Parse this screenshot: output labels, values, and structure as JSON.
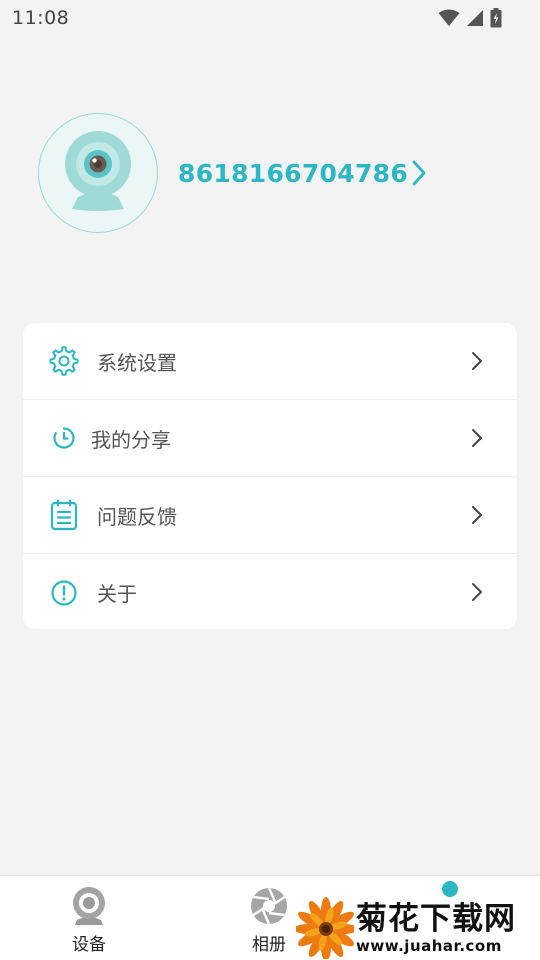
{
  "status_bar": {
    "time": "11:08"
  },
  "profile": {
    "account_id": "8618166704786"
  },
  "menu": {
    "items": [
      {
        "label": "系统设置",
        "icon": "gear-icon"
      },
      {
        "label": "我的分享",
        "icon": "share-refresh-icon"
      },
      {
        "label": "问题反馈",
        "icon": "clipboard-icon"
      },
      {
        "label": "关于",
        "icon": "info-alert-icon"
      }
    ]
  },
  "bottom_nav": {
    "items": [
      {
        "label": "设备",
        "icon": "camera-device-icon"
      },
      {
        "label": "相册",
        "icon": "aperture-icon"
      },
      {
        "label": "",
        "icon": "profile-icon"
      }
    ]
  },
  "watermark": {
    "title": "菊花下载网",
    "url": "www.juahar.com"
  },
  "colors": {
    "accent": "#2bb7c3",
    "icon_teal": "#2bb7c3",
    "background": "#f3f3f3"
  }
}
